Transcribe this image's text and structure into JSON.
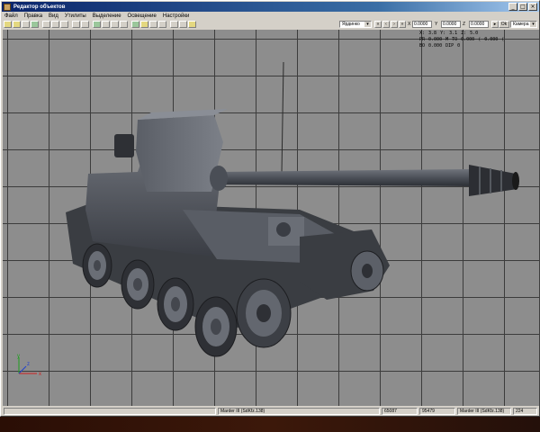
{
  "window": {
    "title": "Редактор объектов",
    "buttons": {
      "minimize": "_",
      "maximize": "□",
      "close": "×"
    }
  },
  "menu": [
    "Файл",
    "Правка",
    "Вид",
    "Утилиты",
    "Выделение",
    "Освещение",
    "Настройки"
  ],
  "toolbar": {
    "view_select": "Ярдинко",
    "x_label": "X",
    "x_value": "0.0000",
    "y_label": "Y",
    "y_value": "0.0000",
    "z_label": "Z",
    "z_value": "0.0000",
    "ok_label": "Ok",
    "camera_select": "Камера"
  },
  "viewport": {
    "info": {
      "row1": [
        "X:",
        "3.8",
        "Y:",
        "3.1",
        "Z:",
        "5.0"
      ],
      "row2": [
        "PR",
        "0.000",
        "M",
        "TO",
        "0.000",
        "(",
        "0.000",
        "("
      ],
      "row3": [
        "BO",
        "0.000",
        "DIP",
        "0"
      ]
    },
    "gizmo": {
      "x": "x",
      "y": "y",
      "z": "z"
    }
  },
  "status": {
    "object_name": "Marder III (SdKfz.138)",
    "count1": "65087",
    "count2": "95479",
    "object_name_2": "Marder III (SdKfz.138)",
    "value": "224"
  }
}
